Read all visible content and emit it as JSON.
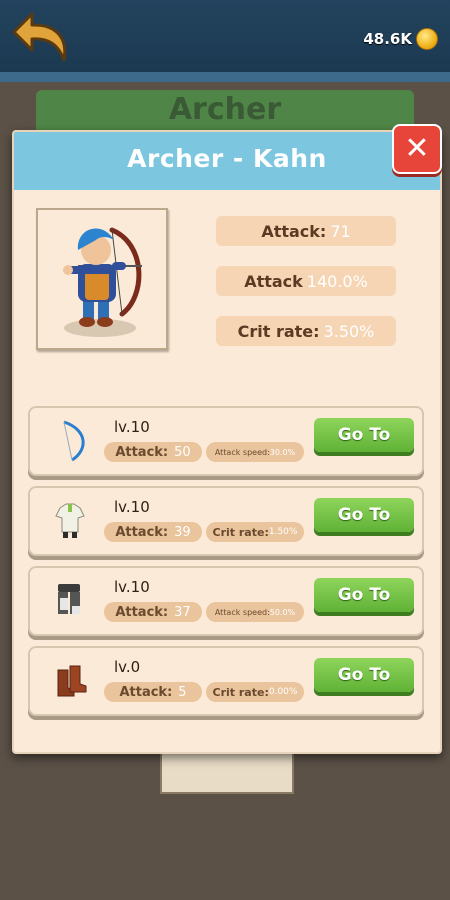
{
  "currency": {
    "amount": "48.6K",
    "icon": "coin-icon"
  },
  "background": {
    "banner_title": "Archer"
  },
  "dialog": {
    "title": "Archer - Kahn",
    "close_label": "✕",
    "stats": [
      {
        "label": "Attack:",
        "value": "71"
      },
      {
        "label": "Attack",
        "value": "140.0%"
      },
      {
        "label": "Crit rate:",
        "value": "3.50%"
      }
    ],
    "equipment": [
      {
        "icon": "bow-icon",
        "level": "lv.10",
        "stat1_label": "Attack:",
        "stat1_value": "50",
        "stat2_label": "Attack speed:",
        "stat2_value": "30.0%",
        "button": "Go To"
      },
      {
        "icon": "shirt-icon",
        "level": "lv.10",
        "stat1_label": "Attack:",
        "stat1_value": "39",
        "stat2_label": "Crit rate:",
        "stat2_value": "1.50%",
        "button": "Go To"
      },
      {
        "icon": "pants-icon",
        "level": "lv.10",
        "stat1_label": "Attack:",
        "stat1_value": "37",
        "stat2_label": "Attack speed:",
        "stat2_value": "50.0%",
        "button": "Go To"
      },
      {
        "icon": "boots-icon",
        "level": "lv.0",
        "stat1_label": "Attack:",
        "stat1_value": "5",
        "stat2_label": "Crit rate:",
        "stat2_value": "0.00%",
        "button": "Go To"
      }
    ]
  },
  "colors": {
    "header": "#7cc6df",
    "go_button": "#6cc23d",
    "close_button": "#e8453a",
    "panel": "#fbead7"
  }
}
